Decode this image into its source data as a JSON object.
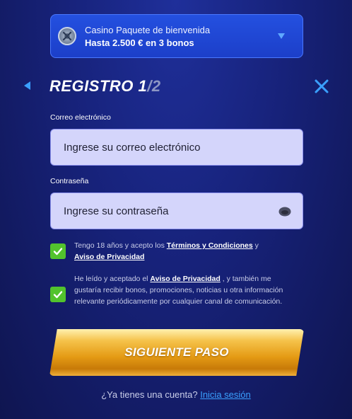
{
  "bonus": {
    "icon": "casino-chip-icon",
    "line1": "Casino Paquete de bienvenida",
    "line2": "Hasta 2.500 € en 3 bonos",
    "expand_icon": "chevron-down-icon"
  },
  "header": {
    "back_icon": "triangle-left-icon",
    "title_prefix": "REGISTRO 1",
    "title_suffix": "/2",
    "close_icon": "close-icon"
  },
  "form": {
    "email_label": "Correo electrónico",
    "email_placeholder": "Ingrese su correo electrónico",
    "password_label": "Contraseña",
    "password_placeholder": "Ingrese su contraseña",
    "password_toggle_icon": "eye-icon"
  },
  "consents": [
    {
      "checked": true,
      "text_before": "Tengo 18 años y acepto los ",
      "link1": "Términos y Condiciones",
      "text_mid": " y ",
      "link2": "Aviso de Privacidad"
    },
    {
      "checked": true,
      "text_before": "He leído y aceptado el ",
      "link1": "Aviso de Privacidad",
      "text_after": " , y también me gustaría recibir bonos, promociones, noticias u otra información relevante periódicamente por cualquier canal de comunicación."
    }
  ],
  "cta": {
    "label": "SIGUIENTE PASO"
  },
  "footer": {
    "question": "¿Ya tienes una cuenta? ",
    "login_link": "Inicia sesión"
  },
  "colors": {
    "background": "#17227a",
    "accent_blue": "#3aa0ff",
    "checkbox_green": "#52c32d",
    "cta_gold": "#e49a14",
    "input_bg": "#d4d5fb"
  }
}
